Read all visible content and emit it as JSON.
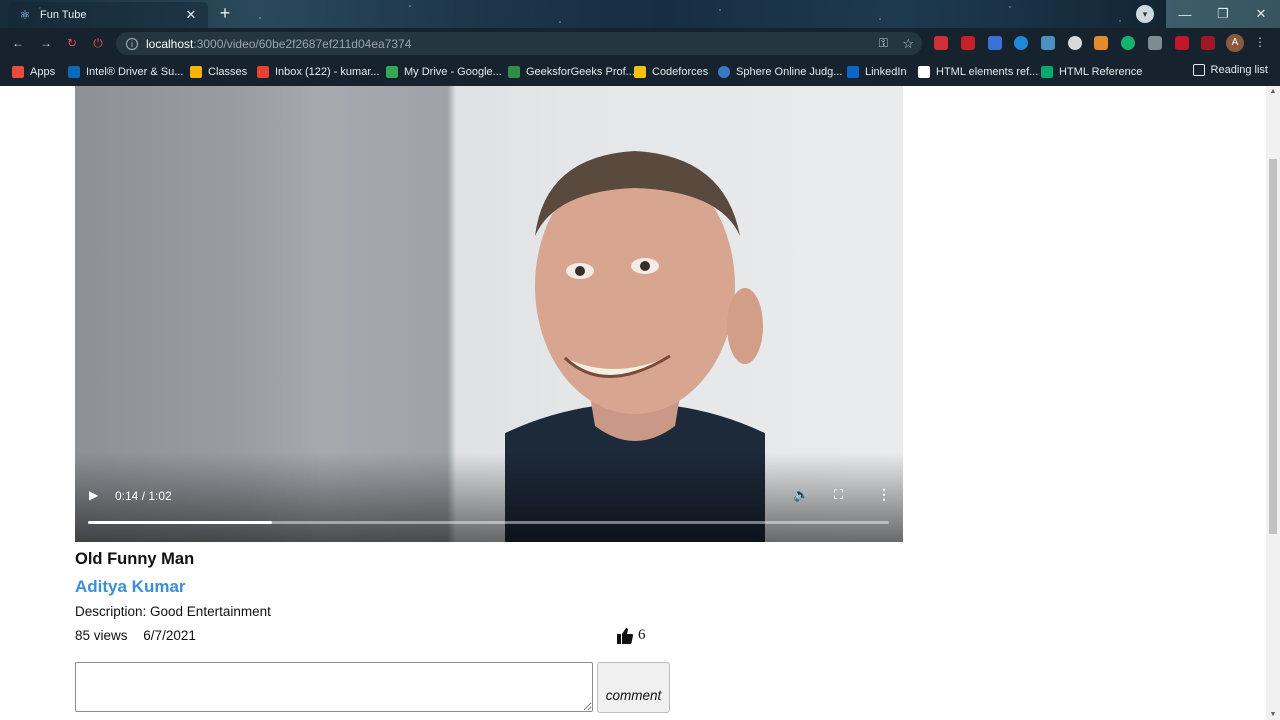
{
  "browser": {
    "tab_title": "Fun Tube",
    "url_host": "localhost",
    "url_path": ":3000/video/60be2f2687ef211d04ea7374",
    "avatar_letter": "A",
    "bookmarks": [
      {
        "label": "Apps"
      },
      {
        "label": "Intel® Driver & Su..."
      },
      {
        "label": "Classes"
      },
      {
        "label": "Inbox (122) - kumar..."
      },
      {
        "label": "My Drive - Google..."
      },
      {
        "label": "GeeksforGeeks Prof..."
      },
      {
        "label": "Codeforces"
      },
      {
        "label": "Sphere Online Judg..."
      },
      {
        "label": "LinkedIn"
      },
      {
        "label": "HTML elements ref..."
      },
      {
        "label": "HTML Reference"
      }
    ],
    "reading_list": "Reading list"
  },
  "video": {
    "time": "0:14 / 1:02",
    "progress_fraction": 0.23,
    "title": "Old Funny Man",
    "author": "Aditya Kumar",
    "description": "Description: Good Entertainment",
    "views": "85 views",
    "date": "6/7/2021",
    "likes": "6"
  },
  "comment": {
    "placeholder": "",
    "button_label": "comment"
  },
  "colors": {
    "author_link": "#3b8fd6",
    "browser_dark": "#0c1a26"
  }
}
